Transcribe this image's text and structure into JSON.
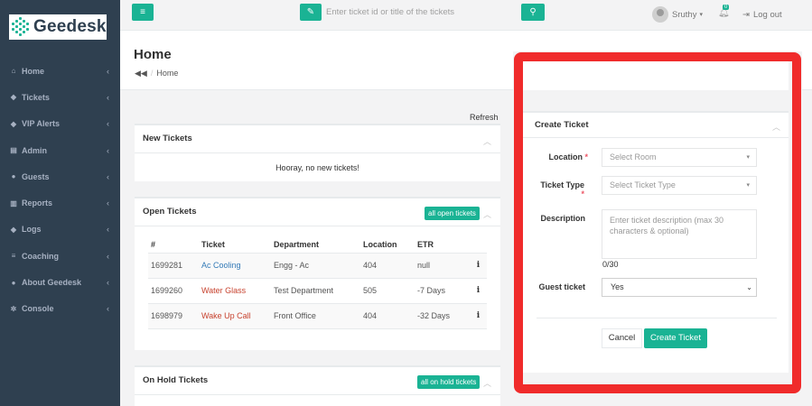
{
  "brand": {
    "name": "Geedesk"
  },
  "sidebar": {
    "items": [
      {
        "label": "Home",
        "icon": "home-icon"
      },
      {
        "label": "Tickets",
        "icon": "tag-icon"
      },
      {
        "label": "VIP Alerts",
        "icon": "tag-icon"
      },
      {
        "label": "Admin",
        "icon": "table-icon"
      },
      {
        "label": "Guests",
        "icon": "users-icon"
      },
      {
        "label": "Reports",
        "icon": "bar-chart-icon"
      },
      {
        "label": "Logs",
        "icon": "tag-icon"
      },
      {
        "label": "Coaching",
        "icon": "list-icon"
      },
      {
        "label": "About Geedesk",
        "icon": "map-marker-icon"
      },
      {
        "label": "Console",
        "icon": "gears-icon"
      }
    ]
  },
  "topbar": {
    "search_placeholder": "Enter ticket id or title of the tickets",
    "user_name": "Sruthy",
    "notification_count": "0",
    "logout_label": "Log out"
  },
  "page": {
    "title": "Home",
    "breadcrumb_current": "Home",
    "refresh_label": "Refresh"
  },
  "new_tickets": {
    "title": "New Tickets",
    "empty_message": "Hooray, no new tickets!"
  },
  "open_tickets": {
    "title": "Open Tickets",
    "all_label": "all open tickets",
    "columns": [
      "#",
      "Ticket",
      "Department",
      "Location",
      "ETR"
    ],
    "rows": [
      {
        "id": "1699281",
        "ticket": "Ac Cooling",
        "department": "Engg - Ac",
        "location": "404",
        "etr": "null"
      },
      {
        "id": "1699260",
        "ticket": "Water Glass",
        "department": "Test Department",
        "location": "505",
        "etr": "-7 Days"
      },
      {
        "id": "1698979",
        "ticket": "Wake Up Call",
        "department": "Front Office",
        "location": "404",
        "etr": "-32 Days"
      }
    ]
  },
  "on_hold_tickets": {
    "title": "On Hold Tickets",
    "all_label": "all on hold tickets"
  },
  "create_ticket": {
    "title": "Create Ticket",
    "location_label": "Location",
    "location_placeholder": "Select Room",
    "ticket_type_label": "Ticket Type",
    "ticket_type_placeholder": "Select Ticket Type",
    "description_label": "Description",
    "description_placeholder": "Enter ticket description (max 30 characters & optional)",
    "char_counter": "0/30",
    "guest_ticket_label": "Guest ticket",
    "guest_ticket_value": "Yes",
    "cancel_label": "Cancel",
    "submit_label": "Create Ticket"
  },
  "colors": {
    "accent": "#1ab394",
    "sidebar": "#2f4050",
    "highlight": "#f02b2b"
  }
}
